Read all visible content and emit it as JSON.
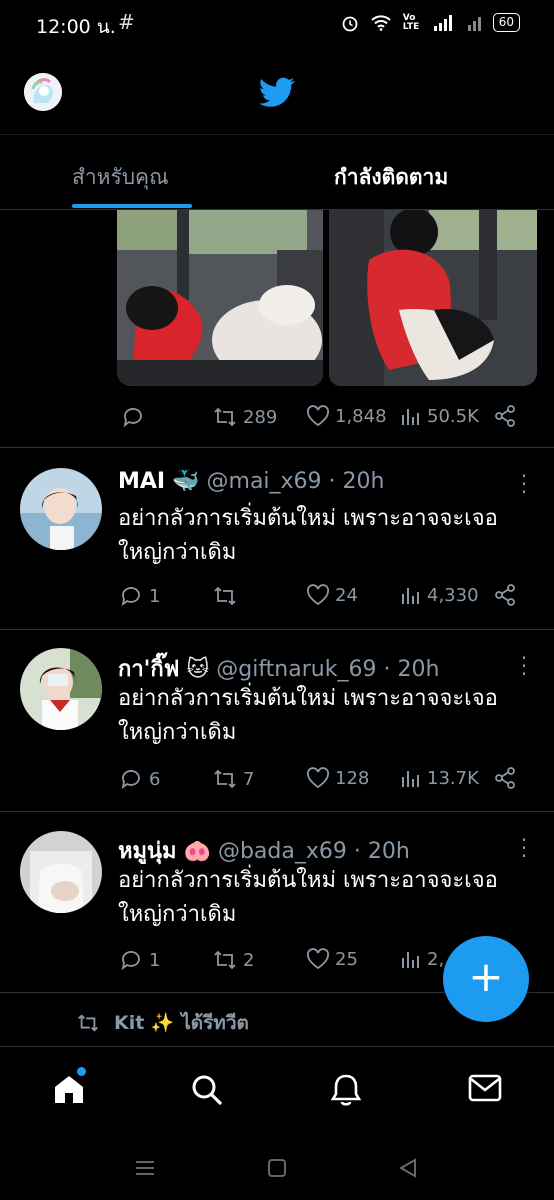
{
  "status": {
    "time": "12:00 น.",
    "grid_icon": "#",
    "volte": "Vo LTE",
    "battery": "60"
  },
  "tabs": {
    "for_you": "สำหรับคุณ",
    "following": "กำลังติดตาม"
  },
  "first_tweet_actions": {
    "reply": "",
    "retweets": "289",
    "likes": "1,848",
    "views": "50.5K"
  },
  "tweets": [
    {
      "name": "MAI",
      "emoji": "🐳",
      "handle": "@mai_x69",
      "time": "· 20h",
      "text": "อย่ากลัวการเริ่มต้นใหม่ เพราะอาจจะเจอใหญ่กว่าเดิม",
      "replies": "1",
      "retweets": "",
      "likes": "24",
      "views": "4,330"
    },
    {
      "name": "กา'กิ๊ฟ",
      "emoji": "🐱",
      "handle": "@giftnaruk_69",
      "time": "· 20h",
      "text": "อย่ากลัวการเริ่มต้นใหม่ เพราะอาจจะเจอใหญ่กว่าเดิม",
      "replies": "6",
      "retweets": "7",
      "likes": "128",
      "views": "13.7K"
    },
    {
      "name": "หมูนุ่ม",
      "emoji": "🐽",
      "handle": "@bada_x69",
      "time": "· 20h",
      "text": "อย่ากลัวการเริ่มต้นใหม่ เพราะอาจจะเจอใหญ่กว่าเดิม",
      "replies": "1",
      "retweets": "2",
      "likes": "25",
      "views": "2,..."
    }
  ],
  "retweet_notice": "Kit ✨ ได้รีทวีต",
  "fab_label": "+",
  "colors": {
    "accent": "#1d9bf0",
    "background": "#000000",
    "muted": "#8b98a5"
  }
}
